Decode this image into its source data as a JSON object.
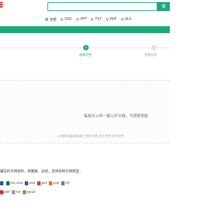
{
  "header": {
    "search_placeholder": "",
    "search_button": "搜"
  },
  "filters": [
    {
      "label": "全部",
      "checked": true
    },
    {
      "label": "DOC",
      "checked": false
    },
    {
      "label": "PPT",
      "checked": false
    },
    {
      "label": "TXT",
      "checked": false
    },
    {
      "label": "PDF",
      "checked": false
    },
    {
      "label": "XLS",
      "checked": false
    }
  ],
  "steps": {
    "step1_number": "1",
    "step1_label": "选择文档",
    "step2_label": "完善信息"
  },
  "upload": {
    "main_text": "每成功上传一篇公开文档，可获取奖励",
    "sub_text": "从我的电脑选择要上传的文档,请上传无水印文档"
  },
  "types_section": {
    "title": "编写的文档资料，如模板、总结，支持多种文档类型：",
    "row1": [
      "",
      "xls,xlsx",
      "vsd",
      "pot",
      "pps",
      "rtf"
    ],
    "row2": [
      "pdf",
      "txt",
      "epub"
    ]
  },
  "colors": {
    "accent": "#1ea97c",
    "logo": "#e8312f"
  }
}
